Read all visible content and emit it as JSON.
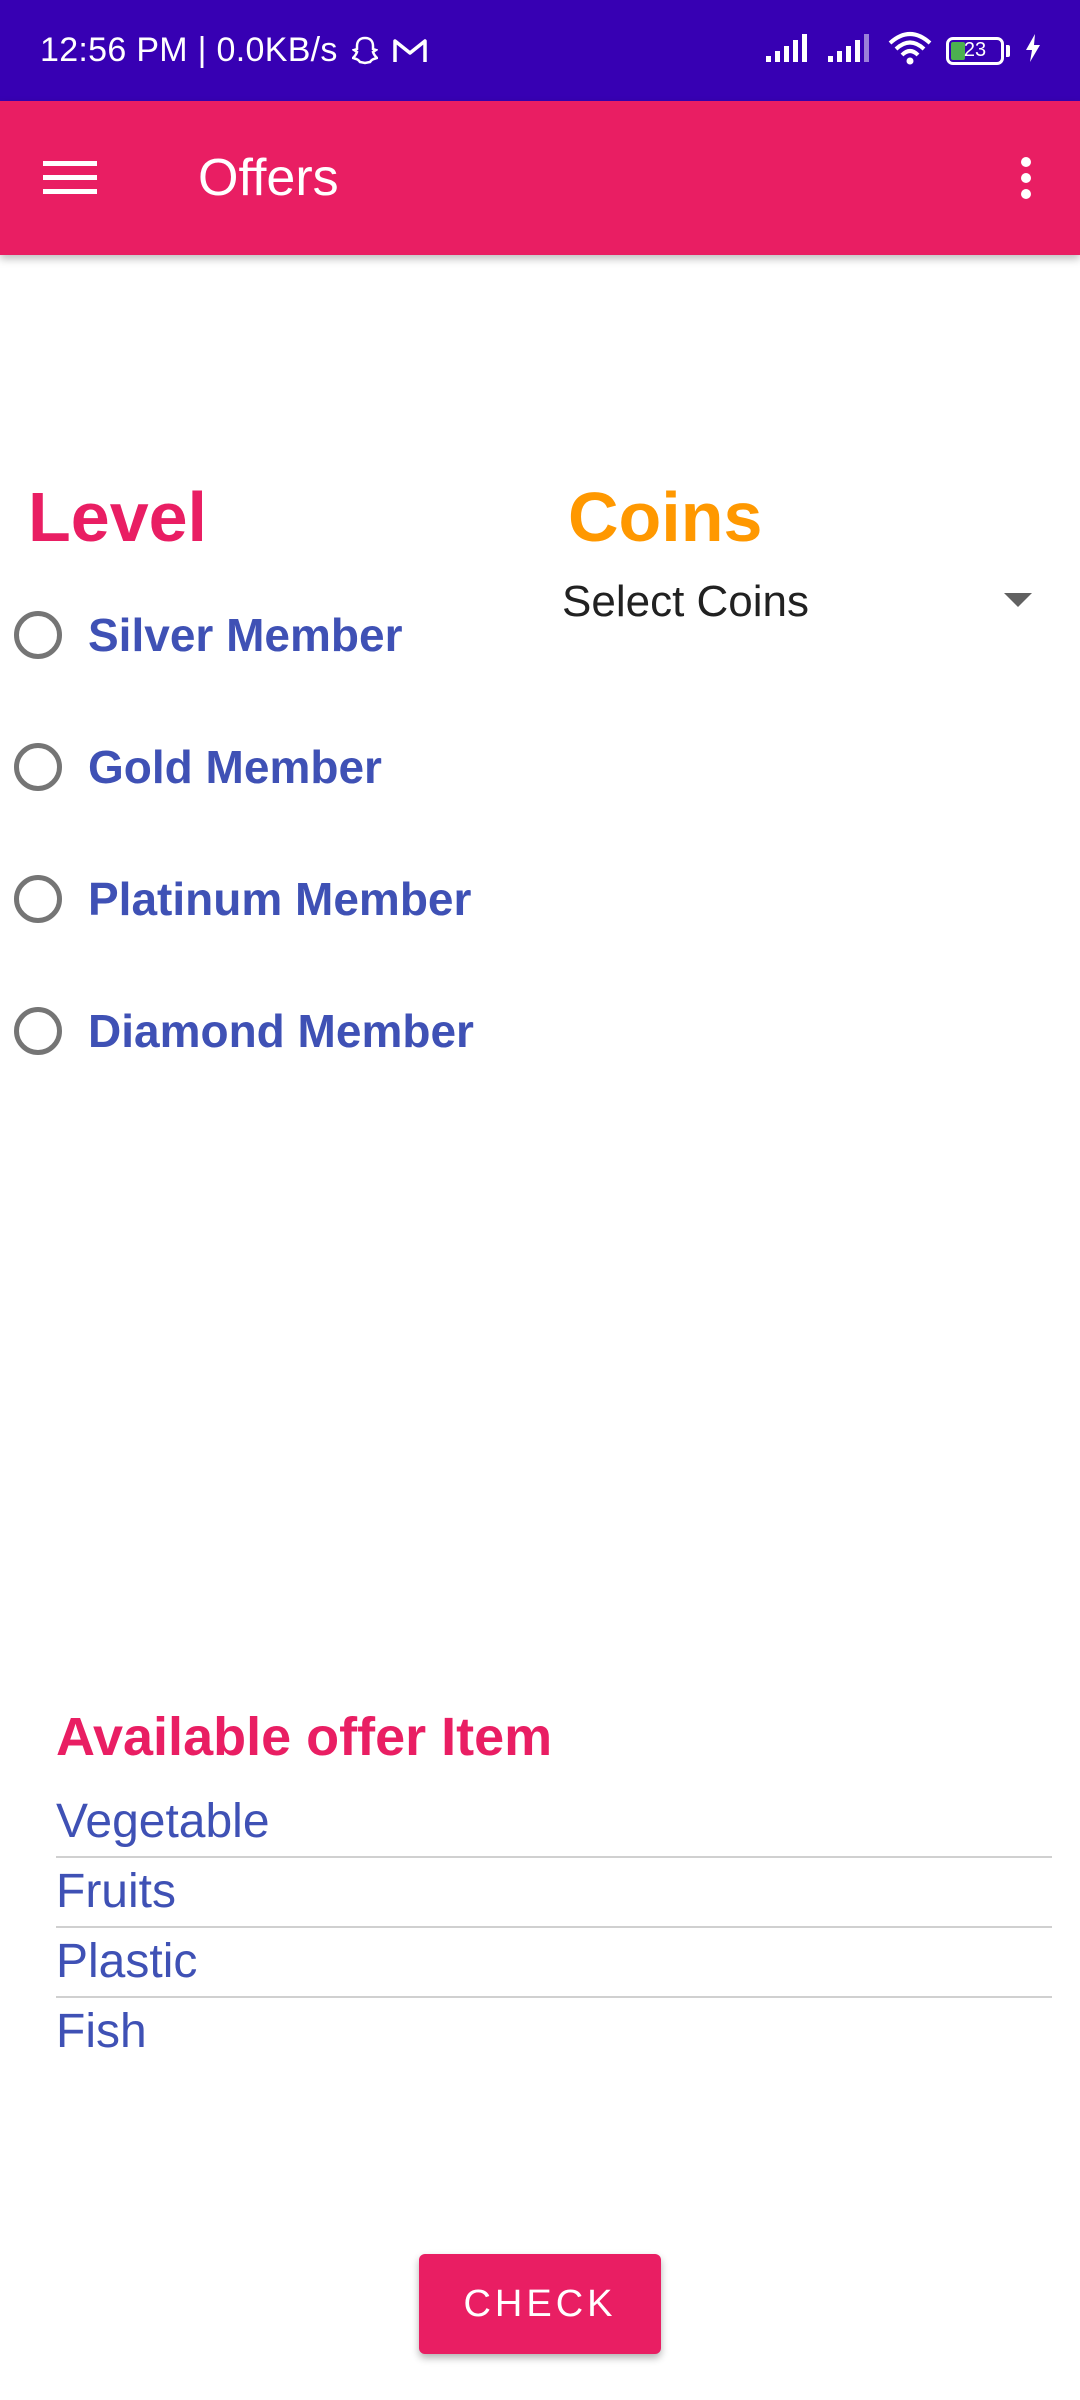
{
  "status_bar": {
    "time_speed": "12:56 PM | 0.0KB/s",
    "battery": "23",
    "icons": [
      "snapchat-icon",
      "gmail-icon",
      "signal-icon",
      "signal-icon",
      "wifi-icon",
      "battery-icon",
      "charging-icon"
    ]
  },
  "app_bar": {
    "title": "Offers",
    "menu_icon": "hamburger-menu-icon",
    "overflow_icon": "more-vert-icon",
    "color": "#e91e63"
  },
  "level": {
    "title": "Level",
    "options": [
      {
        "label": "Silver Member",
        "selected": false
      },
      {
        "label": "Gold Member",
        "selected": false
      },
      {
        "label": "Platinum Member",
        "selected": false
      },
      {
        "label": "Diamond Member",
        "selected": false
      }
    ]
  },
  "coins": {
    "title": "Coins",
    "selected": "Select Coins"
  },
  "offers": {
    "title": "Available offer Item",
    "items": [
      "Vegetable",
      "Fruits",
      "Plastic",
      "Fish"
    ]
  },
  "check_button": {
    "label": "CHECK"
  },
  "colors": {
    "status_bar": "#3700b3",
    "accent": "#e91e63",
    "coins_title": "#ff9800",
    "option_text": "#3f51b5"
  }
}
